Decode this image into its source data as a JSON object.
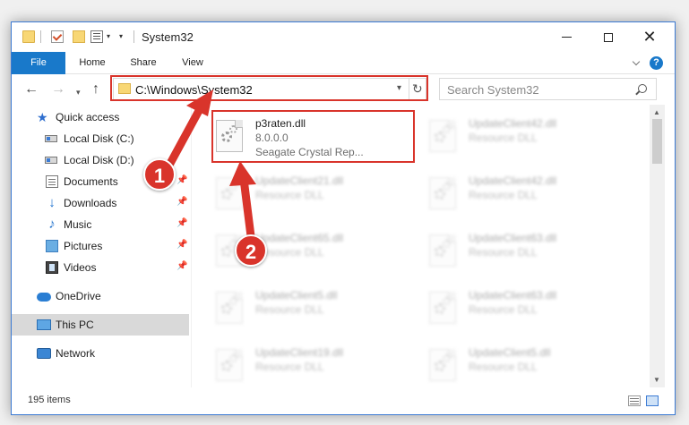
{
  "window": {
    "title": "System32"
  },
  "ribbon": {
    "tabs": [
      "File",
      "Home",
      "Share",
      "View"
    ],
    "file_color": "#1979ca",
    "help_glyph": "?"
  },
  "nav": {
    "address": "C:\\Windows\\System32",
    "search_placeholder": "Search System32"
  },
  "sidebar": {
    "items": [
      {
        "label": "Quick access",
        "icon": "star-icon"
      },
      {
        "label": "Local Disk (C:)",
        "icon": "disk-icon"
      },
      {
        "label": "Local Disk (D:)",
        "icon": "disk-icon"
      },
      {
        "label": "Documents",
        "icon": "documents-icon",
        "pinned": true
      },
      {
        "label": "Downloads",
        "icon": "download-icon",
        "pinned": true
      },
      {
        "label": "Music",
        "icon": "music-icon",
        "pinned": true
      },
      {
        "label": "Pictures",
        "icon": "pictures-icon",
        "pinned": true
      },
      {
        "label": "Videos",
        "icon": "videos-icon",
        "pinned": true
      },
      {
        "label": "OneDrive",
        "icon": "cloud-icon"
      },
      {
        "label": "This PC",
        "icon": "pc-icon",
        "selected": true
      },
      {
        "label": "Network",
        "icon": "network-icon"
      }
    ]
  },
  "files": {
    "left": [
      {
        "name": "p3raten.dll",
        "version": "8.0.0.0",
        "description": "Seagate Crystal Rep..."
      },
      {
        "name": "UpdateClient21.dll",
        "description": "Resource DLL"
      },
      {
        "name": "UpdateClient65.dll",
        "description": "Resource DLL"
      },
      {
        "name": "UpdateClient5.dll",
        "description": "Resource DLL"
      },
      {
        "name": "UpdateClient19.dll",
        "description": "Resource DLL"
      }
    ],
    "right": [
      {
        "name": "UpdateClient42.dll",
        "description": "Resource DLL"
      },
      {
        "name": "UpdateClient42.dll",
        "description": "Resource DLL"
      },
      {
        "name": "UpdateClient63.dll",
        "description": "Resource DLL"
      },
      {
        "name": "UpdateClient63.dll",
        "description": "Resource DLL"
      },
      {
        "name": "UpdateClient5.dll",
        "description": "Resource DLL"
      }
    ]
  },
  "status": {
    "item_count": "195 items"
  },
  "callouts": [
    "1",
    "2"
  ],
  "colors": {
    "highlight": "#d9342b",
    "accent": "#1979ca"
  }
}
